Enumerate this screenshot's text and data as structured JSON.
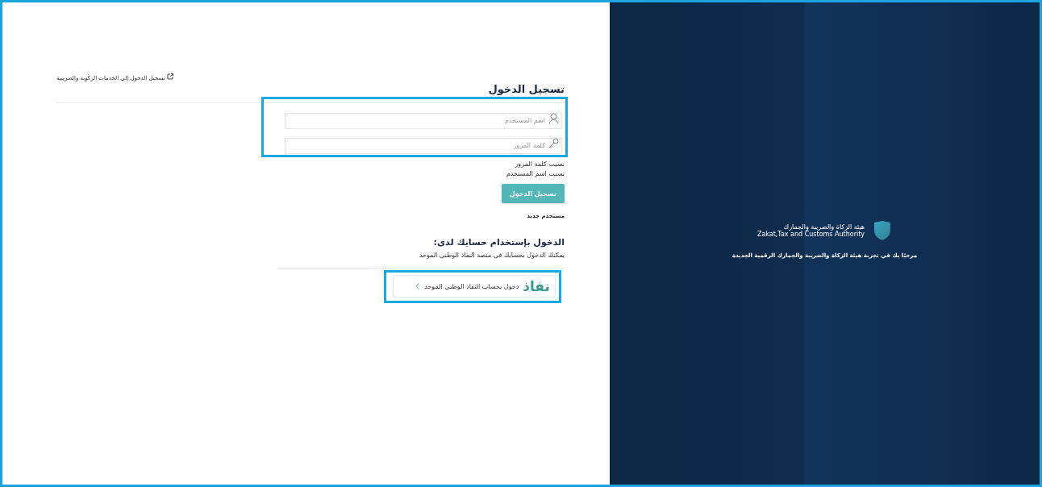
{
  "login_panel": {
    "external_link": "تسجيل الدخول إلى الخدمات الزكوية والضريبية",
    "title": "تسجيل الدخول",
    "fields": [
      {
        "kind": "user",
        "placeholder": "اسم المستخدم"
      },
      {
        "kind": "key",
        "placeholder": "كلمة المرور"
      }
    ],
    "links": [
      "نسيت كلمة المرور",
      "نسيت اسم المستخدم"
    ],
    "submit": "تسجيل الدخول",
    "new_user": "مستخدم جديد",
    "alt_title": "الدخول بإستخدام حسابك لدى:",
    "alt_description": "يمكنك الدخول بحسابك في منصة النفاذ الوطني الموحد",
    "nafath": {
      "logo": "نفاذ",
      "label": "دخول بحساب النفاذ الوطني الموحد"
    }
  },
  "brand_panel": {
    "name_ar": "هيئة الزكاة والضريبة والجمارك",
    "name_en": "Zakat,Tax and Customs Authority",
    "welcome": "مرحبًا بك في تجربة هيئة الزكاة والضريبة والجمارك الرقمية الجديدة"
  }
}
